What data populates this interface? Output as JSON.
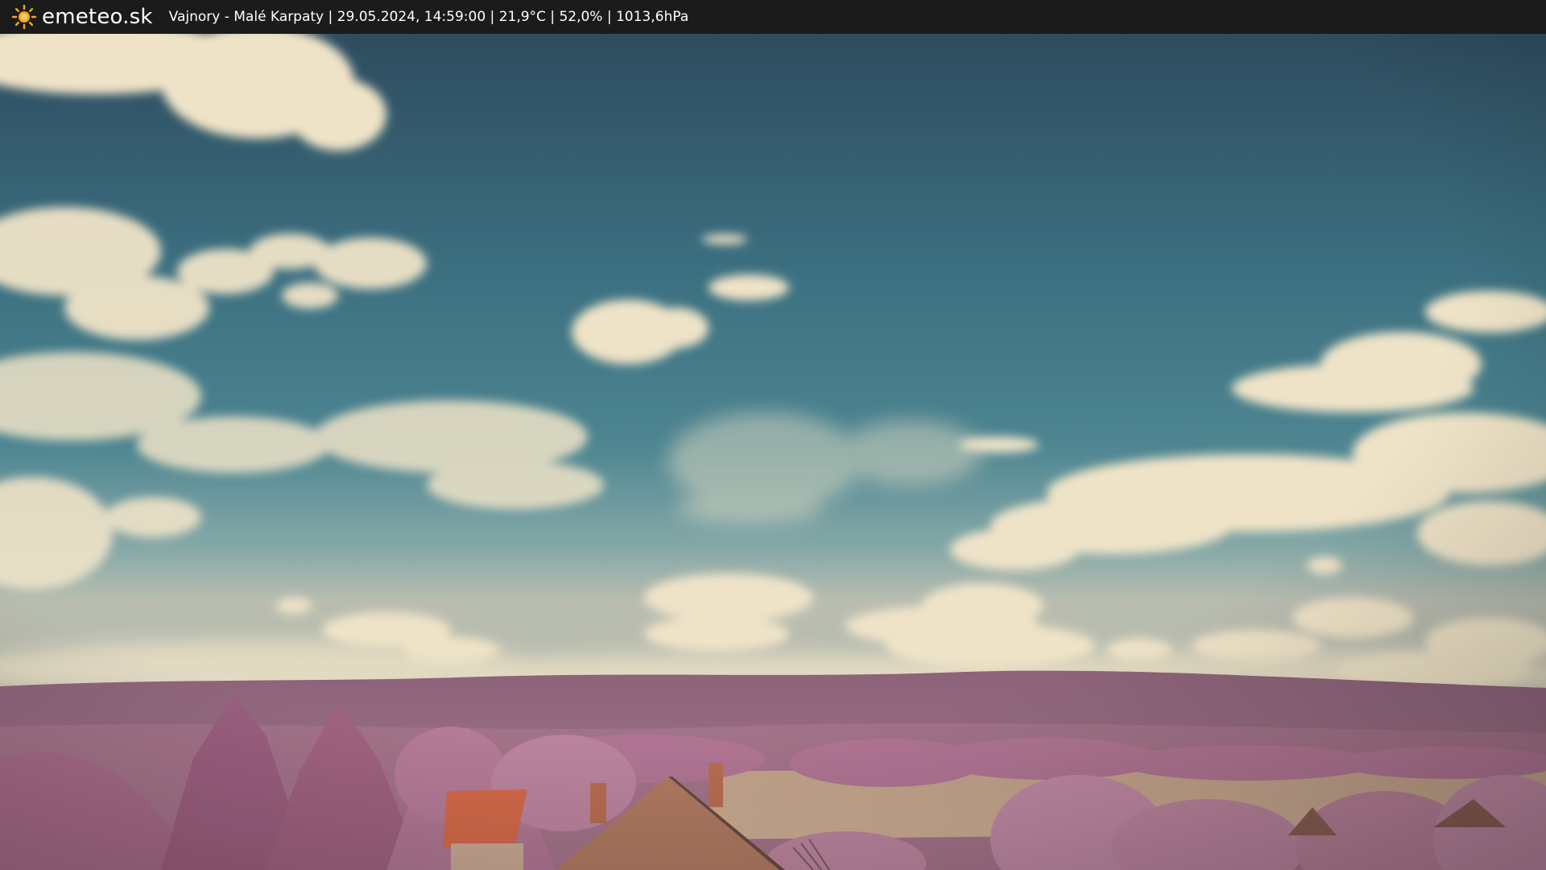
{
  "header": {
    "brand": "emeteo.sk",
    "brand_icon": "sun-icon",
    "caption": "Vajnory - Malé Karpaty | 29.05.2024, 14:59:00 | 21,9°C | 52,0% | 1013,6hPa"
  },
  "colors": {
    "bar_background": "#1b1b1b",
    "sun": "#f5a623",
    "sky_top": "#2f4f60",
    "sky_mid": "#3f7585",
    "sky_horizon": "#8fb0ad",
    "cloud": "#efe4c8",
    "hills": "#9a6f86",
    "trees": "#b4789a",
    "roof": "#d46a4a",
    "field": "#c8a88e"
  }
}
